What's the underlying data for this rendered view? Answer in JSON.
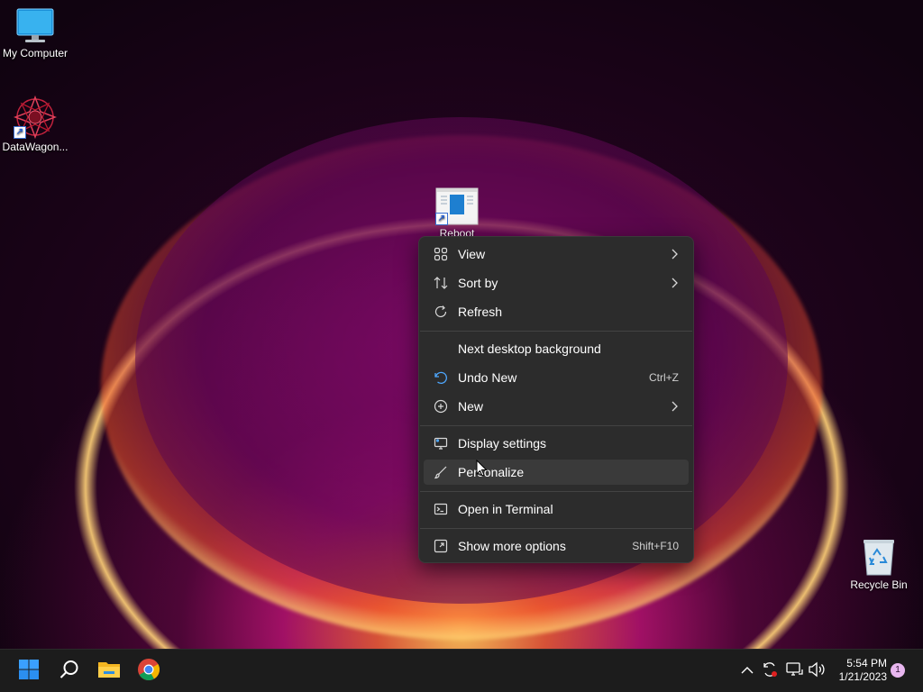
{
  "desktop": {
    "icons": [
      {
        "label": "My Computer"
      },
      {
        "label": "DataWagon..."
      },
      {
        "label": "Reboot"
      },
      {
        "label": "Recycle Bin"
      }
    ]
  },
  "context_menu": {
    "items": [
      {
        "label": "View",
        "icon": "grid-view-icon",
        "submenu": true
      },
      {
        "label": "Sort by",
        "icon": "sort-icon",
        "submenu": true
      },
      {
        "label": "Refresh",
        "icon": "refresh-icon"
      },
      {
        "label": "Next desktop background"
      },
      {
        "label": "Undo New",
        "icon": "undo-icon",
        "shortcut": "Ctrl+Z"
      },
      {
        "label": "New",
        "icon": "plus-circle-icon",
        "submenu": true
      },
      {
        "label": "Display settings",
        "icon": "display-icon"
      },
      {
        "label": "Personalize",
        "icon": "brush-icon",
        "hovered": true
      },
      {
        "label": "Open in Terminal",
        "icon": "terminal-icon"
      },
      {
        "label": "Show more options",
        "icon": "more-options-icon",
        "shortcut": "Shift+F10"
      }
    ]
  },
  "taskbar": {
    "apps": [
      {
        "name": "Start",
        "icon": "windows-logo-icon"
      },
      {
        "name": "Search",
        "icon": "search-icon"
      },
      {
        "name": "File Explorer",
        "icon": "folder-icon"
      },
      {
        "name": "Google Chrome",
        "icon": "chrome-icon"
      }
    ],
    "tray": {
      "icons": [
        "chevron-up-icon",
        "sync-icon",
        "network-icon",
        "volume-icon"
      ],
      "time": "5:54 PM",
      "date": "1/21/2023",
      "notification_count": "1"
    }
  },
  "colors": {
    "menu_bg": "#2c2c2c",
    "menu_hover": "#3a3a3a",
    "accent": "#0a84ff",
    "taskbar_bg": "#1c1c1c"
  }
}
